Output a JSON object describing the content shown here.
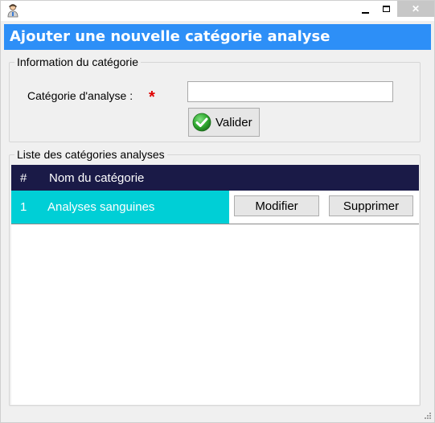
{
  "window": {
    "minimize_icon": "minimize-icon",
    "maximize_icon": "maximize-icon",
    "close_icon": "close-icon",
    "close_glyph": "✕"
  },
  "header": {
    "title": "Ajouter une nouvelle catégorie analyse",
    "color": "#2d8ff7"
  },
  "info_group": {
    "legend": "Information du catégorie",
    "field_label": "Catégorie d'analyse :",
    "required_mark": "*",
    "input_value": "",
    "submit_label": "Valider",
    "submit_icon": "check-icon"
  },
  "list_group": {
    "legend": "Liste des catégories analyses",
    "columns": [
      "#",
      "Nom du catégorie"
    ],
    "header_color": "#1a1a47",
    "row_color": "#00cfd6",
    "rows": [
      {
        "num": "1",
        "name": "Analyses sanguines",
        "edit_label": "Modifier",
        "delete_label": "Supprimer"
      }
    ]
  }
}
